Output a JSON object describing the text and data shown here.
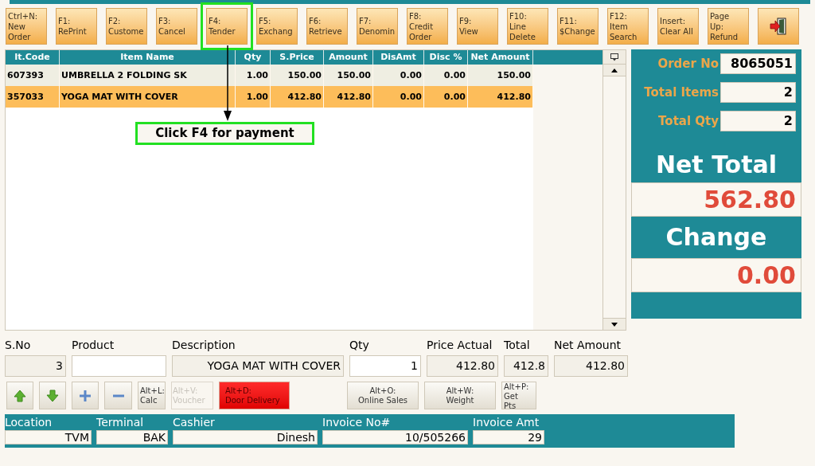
{
  "toolbar": [
    {
      "label": "Ctrl+N:\nNew\nOrder",
      "highlighted": false
    },
    {
      "label": "F1:\nRePrint",
      "highlighted": false
    },
    {
      "label": "F2:\nCustome",
      "highlighted": false
    },
    {
      "label": "F3:\nCancel",
      "highlighted": false
    },
    {
      "label": "F4:\nTender",
      "highlighted": true
    },
    {
      "label": "F5:\nExchang",
      "highlighted": false
    },
    {
      "label": "F6:\nRetrieve",
      "highlighted": false
    },
    {
      "label": "F7:\nDenomin",
      "highlighted": false
    },
    {
      "label": "F8:\nCredit\nOrder",
      "highlighted": false
    },
    {
      "label": "F9:\nView",
      "highlighted": false
    },
    {
      "label": "F10:\nLine\nDelete",
      "highlighted": false
    },
    {
      "label": "F11:\n$Change",
      "highlighted": false
    },
    {
      "label": "F12:\nItem\nSearch",
      "highlighted": false
    },
    {
      "label": "Insert:\nClear All",
      "highlighted": false
    },
    {
      "label": "Page\nUp:\nRefund",
      "highlighted": false
    }
  ],
  "callout": "Click F4 for payment",
  "table": {
    "columns": [
      "It.Code",
      "Item Name",
      "Qty",
      "S.Price",
      "Amount",
      "DisAmt",
      "Disc %",
      "Net Amount"
    ],
    "rows": [
      {
        "cells": [
          "607393",
          "UMBRELLA 2 FOLDING SK",
          "1.00",
          "150.00",
          "150.00",
          "0.00",
          "0.00",
          "150.00"
        ],
        "selected": false
      },
      {
        "cells": [
          "357033",
          "YOGA MAT WITH COVER",
          "1.00",
          "412.80",
          "412.80",
          "0.00",
          "0.00",
          "412.80"
        ],
        "selected": true
      }
    ]
  },
  "summary": {
    "fields": [
      {
        "label": "Order No",
        "value": "8065051"
      },
      {
        "label": "Total Items",
        "value": "2"
      },
      {
        "label": "Total Qty",
        "value": "2"
      }
    ],
    "net_total_label": "Net Total",
    "net_total": "562.80",
    "change_label": "Change",
    "change": "0.00"
  },
  "entry": {
    "columns": [
      "S.No",
      "Product",
      "Description",
      "Qty",
      "Price Actual",
      "Total",
      "Net Amount"
    ],
    "cells": [
      {
        "text": "3",
        "editable": false
      },
      {
        "editable": true
      },
      {
        "text": "YOGA MAT WITH COVER",
        "editable": false
      },
      {
        "text": "1",
        "editable": true
      },
      {
        "text": "412.80",
        "editable": false
      },
      {
        "text": "412.8",
        "editable": false
      },
      {
        "text": "412.80",
        "editable": false
      }
    ]
  },
  "actions": [
    {
      "kind": "up"
    },
    {
      "kind": "down"
    },
    {
      "kind": "plus"
    },
    {
      "kind": "minus"
    },
    {
      "kind": "text",
      "label": "Alt+L:\nCalc",
      "disabled": false
    },
    {
      "kind": "text",
      "label": "Alt+V:\nVoucher",
      "disabled": true
    },
    {
      "kind": "alert",
      "label": "Alt+D:\nDoor Delivery",
      "disabled": false
    },
    {
      "kind": "text",
      "label": "Alt+O:\nOnline Sales",
      "disabled": false
    },
    {
      "kind": "text",
      "label": "Alt+W:\nWeight",
      "disabled": false
    },
    {
      "kind": "text",
      "label": "Alt+P:\nGet\nPts",
      "disabled": false
    }
  ],
  "status": {
    "columns": [
      "Location",
      "Terminal",
      "Cashier",
      "Invoice No#",
      "Invoice Amt"
    ],
    "cells": [
      "TVM",
      "BAK",
      "Dinesh",
      "10/505266",
      "29"
    ]
  }
}
